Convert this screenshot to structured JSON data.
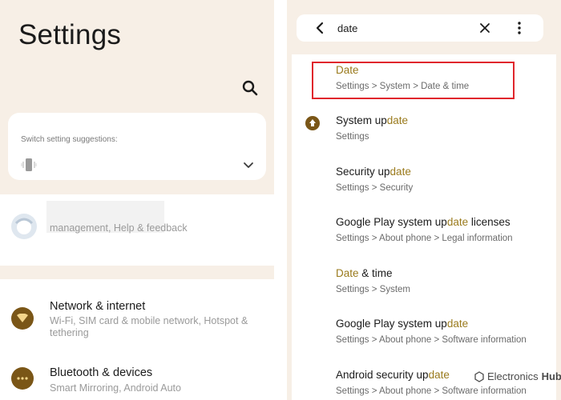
{
  "left": {
    "title": "Settings",
    "suggestions": {
      "label": "Switch setting suggestions:"
    },
    "account": {
      "text": "management, Help & feedback"
    },
    "items": [
      {
        "title": "Network & internet",
        "subtitle": "Wi-Fi, SIM card & mobile network, Hotspot & tethering",
        "icon": "wifi-icon"
      },
      {
        "title": "Bluetooth & devices",
        "subtitle": "Smart Mirroring, Android Auto",
        "icon": "more-dots-icon"
      }
    ]
  },
  "right": {
    "search": {
      "value": "date"
    },
    "results": [
      {
        "pre": "",
        "hl": "Date",
        "post": "",
        "path": "Settings > System > Date & time",
        "highlighted": true
      },
      {
        "pre": "System up",
        "hl": "date",
        "post": "",
        "path": "Settings",
        "has_icon": true
      },
      {
        "pre": "Security up",
        "hl": "date",
        "post": "",
        "path": "Settings > Security"
      },
      {
        "pre": "Google Play system up",
        "hl": "date",
        "post": " licenses",
        "path": "Settings > About phone > Legal information"
      },
      {
        "pre": "",
        "hl": "Date",
        "post": " & time",
        "path": "Settings > System"
      },
      {
        "pre": "Google Play system up",
        "hl": "date",
        "post": "",
        "path": "Settings > About phone > Software information"
      },
      {
        "pre": "Android security up",
        "hl": "date",
        "post": "",
        "path": "Settings > About phone > Software information"
      }
    ],
    "watermark": {
      "brand": "Electronics",
      "suffix": "Hub"
    }
  },
  "colors": {
    "panel_bg": "#f7efe6",
    "accent": "#9a7a1c",
    "icon_bg": "#7a5617",
    "highlight_box": "#e0262c"
  }
}
